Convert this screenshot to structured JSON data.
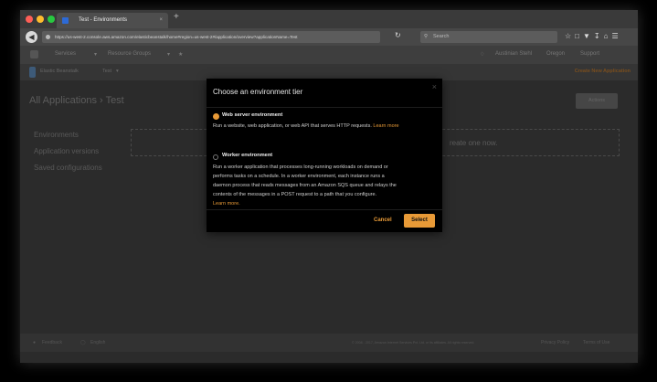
{
  "browser": {
    "tab_title": "Test - Environments",
    "tab_close": "×",
    "new_tab": "+",
    "url": "https://us-west-2.console.aws.amazon.com/elasticbeanstalk/home#region=us-west-2#/application/overview?applicationName=Test",
    "search_placeholder": "Search"
  },
  "aws_nav": {
    "services": "Services",
    "resource_groups": "Resource Groups",
    "user": "Austinian Stehl",
    "region": "Oregon",
    "support": "Support"
  },
  "eb_bar": {
    "service_name": "Elastic Beanstalk",
    "app_selector": "Test",
    "create_app": "Create New Application"
  },
  "page": {
    "breadcrumb": "All Applications › Test",
    "actions": "Actions",
    "hint": "reate one now."
  },
  "sidebar": {
    "items": [
      {
        "label": "Environments"
      },
      {
        "label": "Application versions"
      },
      {
        "label": "Saved configurations"
      }
    ]
  },
  "modal": {
    "title": "Choose an environment tier",
    "close": "×",
    "options": [
      {
        "label": "Web server environment",
        "selected": true,
        "desc_lines": [
          "Run a website, web application, or web API that serves HTTP requests."
        ],
        "learn_more": "Learn more"
      },
      {
        "label": "Worker environment",
        "selected": false,
        "desc_lines": [
          "Run a worker application that processes long-running workloads on demand or",
          "performs tasks on a schedule. In a worker environment, each instance runs a",
          "daemon process that reads messages from an Amazon SQS queue and relays the",
          "contents of the messages in a POST request to a path that you configure."
        ],
        "learn_more": "Learn more."
      }
    ],
    "cancel": "Cancel",
    "select": "Select"
  },
  "footer": {
    "feedback": "Feedback",
    "language": "English",
    "copyright": "© 2008 - 2017, Amazon Internet Services Pvt. Ltd. or its affiliates. All rights reserved.",
    "privacy": "Privacy Policy",
    "terms": "Terms of Use"
  },
  "colors": {
    "accent": "#e89a37",
    "modal_bg": "#000000",
    "page_bg": "#2b2b2b"
  }
}
